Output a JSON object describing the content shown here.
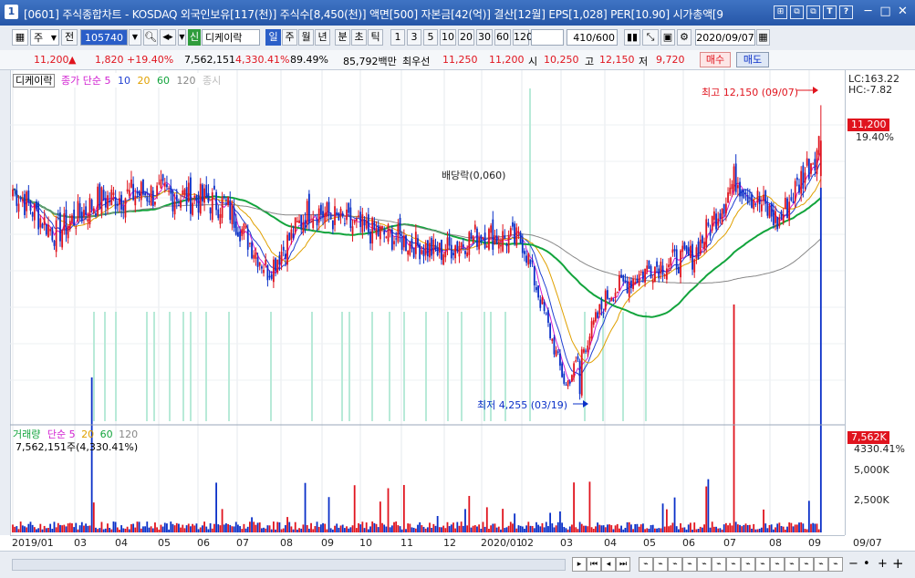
{
  "window": {
    "number": "1",
    "title": "[0601] 주식종합차트 - KOSDAQ 외국인보유[117(천)] 주식수[8,450(천)] 액면[500] 자본금[42(억)] 결산[12월] EPS[1,028] PER[10.90] 시가총액[9",
    "tool_buttons": [
      "⊞",
      "⧉",
      "⧉",
      "T",
      "?"
    ],
    "window_buttons": [
      "─",
      "□",
      "✕"
    ]
  },
  "toolbar": {
    "market_label": "주",
    "prev_label": "전",
    "code_value": "105740",
    "sin_label": "신",
    "stock_name": "디케이락",
    "period_tabs": [
      "일",
      "주",
      "월",
      "년",
      "분",
      "초",
      "틱"
    ],
    "active_period": "일",
    "interval_buttons": [
      "1",
      "3",
      "5",
      "10",
      "20",
      "30",
      "60",
      "120"
    ],
    "count_value": "410",
    "count_total": "/600",
    "date_value": "2020/09/07"
  },
  "info": {
    "price": "11,200",
    "change": "1,820",
    "change_pct": "+19.40%",
    "volume": "7,562,151",
    "volume_pct": "4,330.41%",
    "turnover": "89.49%",
    "amount": "85,792백만",
    "best_ask_label": "최우선",
    "best_ask": "11,250",
    "best_bid": "11,200",
    "open_label": "시",
    "open": "10,250",
    "high_label": "고",
    "high": "12,150",
    "low_label": "저",
    "low": "9,720",
    "buy_label": "매수",
    "sell_label": "매도"
  },
  "price_panel": {
    "stock_tag": "디케이락",
    "legend_prefix": "종가 단순",
    "legend_periods": [
      "5",
      "10",
      "20",
      "60",
      "120"
    ],
    "legend_extra": "종시",
    "dividend_label": "배당락(0,060)",
    "high_annotation": "최고 12,150 (09/07)",
    "low_annotation": "최저 4,255 (03/19)",
    "lc_label": "LC:163.22",
    "hc_label": "HC:-7.82",
    "current_price_tag": "11,200",
    "current_pct_tag": "19.40%"
  },
  "volume_panel": {
    "legend_title": "거래량",
    "legend_prefix": "단순",
    "legend_periods": [
      "5",
      "20",
      "60",
      "120"
    ],
    "value_label": "7,562,151주(4,330.41%)",
    "current_tag": "7,562K",
    "current_pct_tag": "4330.41%",
    "y_ticks": [
      "5,000K",
      "2,500K"
    ]
  },
  "x_axis_labels": [
    "2019/01",
    "03",
    "04",
    "05",
    "06",
    "07",
    "08",
    "09",
    "10",
    "11",
    "12",
    "2020/01",
    "02",
    "03",
    "04",
    "05",
    "06",
    "07",
    "08",
    "09",
    "09/07"
  ],
  "colors": {
    "up": "#e0141e",
    "down": "#0a30c8",
    "ma5": "#d11fd1",
    "ma10": "#1f3fd1",
    "ma20": "#e0a000",
    "ma60": "#12a43c",
    "ma120": "#888888",
    "title_bar": "#2f63b8"
  },
  "chart_data": {
    "type": "candlestick",
    "price_high": 12150,
    "price_high_date": "09/07",
    "price_low": 4255,
    "price_low_date": "03/19",
    "last_close": 11200,
    "last_volume": 7562151,
    "volume_ticks": [
      5000000,
      2500000
    ],
    "months": [
      "2019/01",
      "03",
      "04",
      "05",
      "06",
      "07",
      "08",
      "09",
      "10",
      "11",
      "12",
      "2020/01",
      "02",
      "03",
      "04",
      "05",
      "06",
      "07",
      "08",
      "09"
    ],
    "series": [
      {
        "name": "5",
        "values": []
      },
      {
        "name": "10",
        "values": []
      },
      {
        "name": "20",
        "values": []
      },
      {
        "name": "60",
        "values": []
      },
      {
        "name": "120",
        "values": []
      }
    ],
    "monthly_close_estimate": [
      9900,
      8700,
      9600,
      9800,
      9700,
      9500,
      7700,
      9400,
      8900,
      8600,
      8200,
      8700,
      8500,
      4600,
      7100,
      7800,
      8100,
      10200,
      9000,
      11200
    ]
  }
}
